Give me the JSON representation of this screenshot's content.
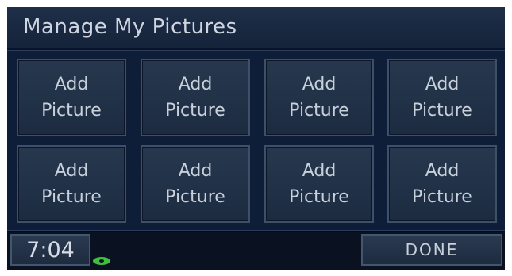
{
  "header": {
    "title": "Manage My Pictures"
  },
  "picture_slots": [
    {
      "line1": "Add",
      "line2": "Picture"
    },
    {
      "line1": "Add",
      "line2": "Picture"
    },
    {
      "line1": "Add",
      "line2": "Picture"
    },
    {
      "line1": "Add",
      "line2": "Picture"
    },
    {
      "line1": "Add",
      "line2": "Picture"
    },
    {
      "line1": "Add",
      "line2": "Picture"
    },
    {
      "line1": "Add",
      "line2": "Picture"
    },
    {
      "line1": "Add",
      "line2": "Picture"
    }
  ],
  "status": {
    "time": "7:04",
    "disc_icon": "disc-icon"
  },
  "footer": {
    "done_label": "DONE"
  },
  "colors": {
    "background": "#050a14",
    "tile": "#27384e",
    "text": "#c8d0dc",
    "disc": "#3fbf3f"
  }
}
